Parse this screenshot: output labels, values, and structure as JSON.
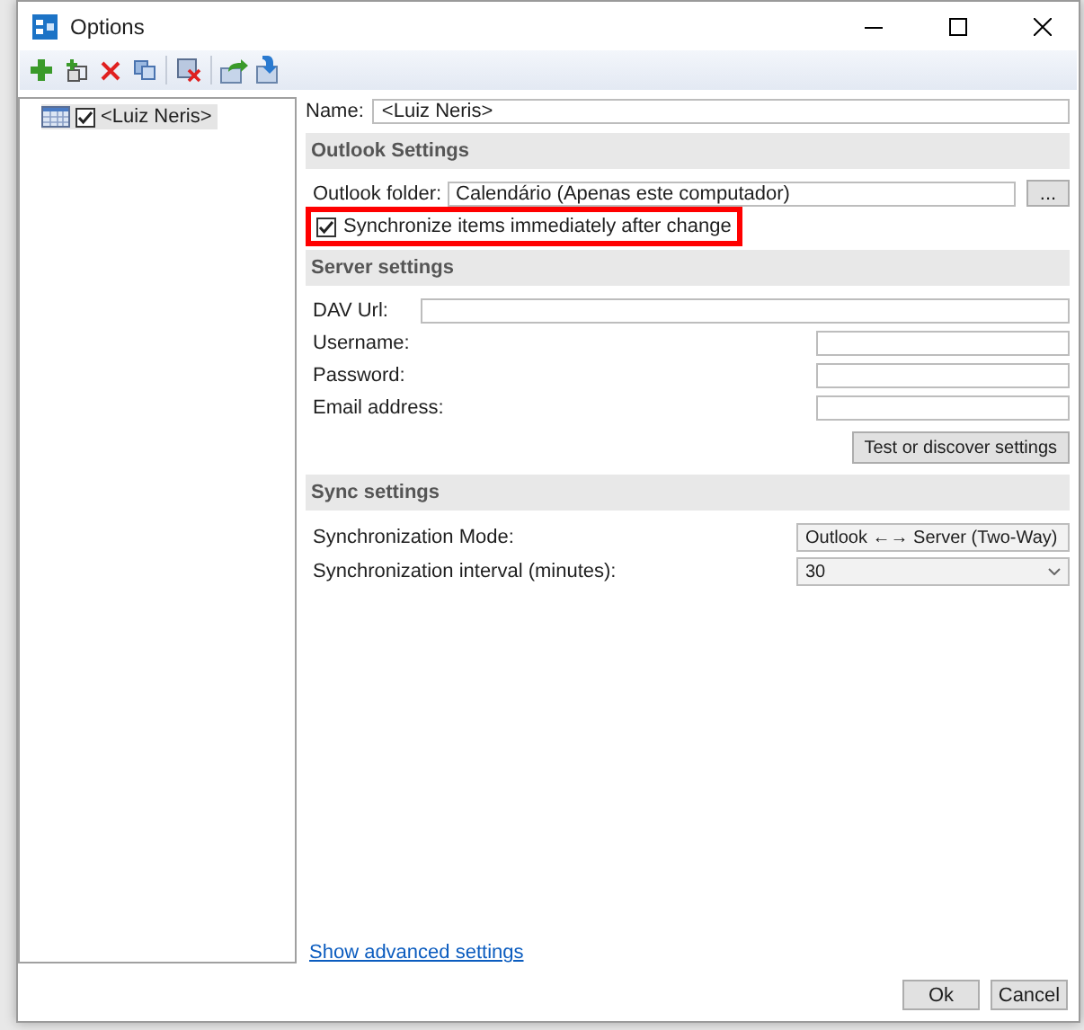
{
  "window": {
    "title": "Options"
  },
  "tree": {
    "items": [
      {
        "label": "<Luiz Neris>",
        "checked": true,
        "selected": true
      }
    ]
  },
  "name": {
    "label": "Name:",
    "value": "<Luiz Neris>"
  },
  "outlook_settings": {
    "title": "Outlook Settings",
    "folder_label": "Outlook folder:",
    "folder_value": "Calendário (Apenas este computador)",
    "browse_button": "...",
    "sync_checkbox": {
      "label": "Synchronize items immediately after change",
      "checked": true,
      "highlighted": true
    }
  },
  "server_settings": {
    "title": "Server settings",
    "fields": [
      {
        "label": "DAV Url:",
        "kind": "wide"
      },
      {
        "label": "Username:",
        "kind": "short"
      },
      {
        "label": "Password:",
        "kind": "short"
      },
      {
        "label": "Email address:",
        "kind": "short"
      }
    ],
    "button": "Test or discover settings"
  },
  "sync_settings": {
    "title": "Sync settings",
    "rows": [
      {
        "label": "Synchronization Mode:",
        "value": "Outlook ←→ Server (Two-Way)"
      },
      {
        "label": "Synchronization interval (minutes):",
        "value": "30"
      }
    ]
  },
  "advanced_link": "Show advanced settings",
  "buttons": [
    "Ok",
    "Cancel"
  ]
}
